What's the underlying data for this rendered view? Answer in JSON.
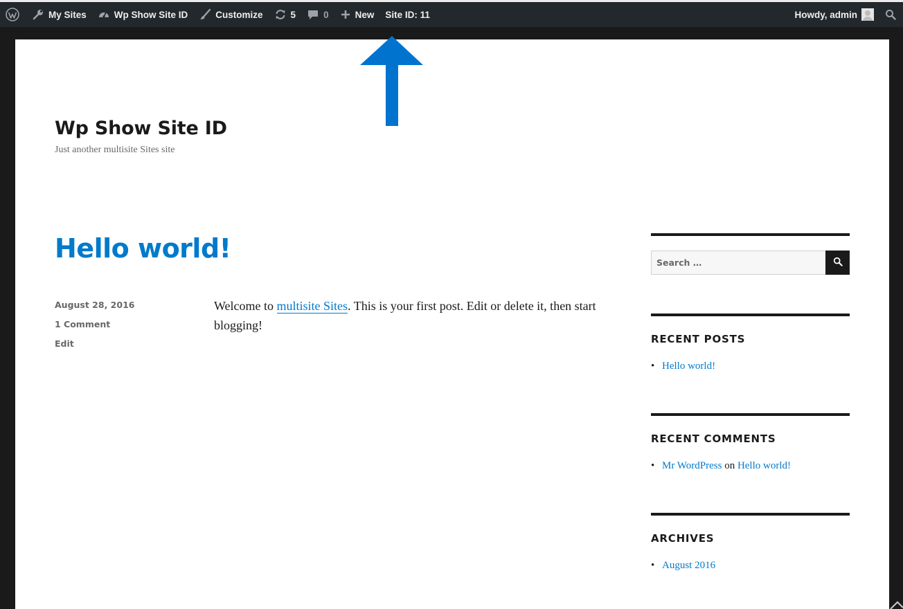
{
  "admin_bar": {
    "wp_logo_icon": "wordpress-logo-icon",
    "my_sites": "My Sites",
    "site_name": "Wp Show Site ID",
    "customize": "Customize",
    "updates_count": "5",
    "comments_count": "0",
    "new": "New",
    "site_id": "Site ID: 11",
    "howdy": "Howdy, admin",
    "colors": {
      "bg": "#23282d",
      "text": "#eeeeee",
      "muted": "#9ca2a7"
    }
  },
  "site": {
    "title": "Wp Show Site ID",
    "description": "Just another multisite Sites site"
  },
  "post": {
    "title": "Hello world!",
    "date": "August 28, 2016",
    "comments": "1 Comment",
    "edit": "Edit",
    "body_prefix": "Welcome to ",
    "body_link": "multisite Sites",
    "body_suffix": ". This is your first post. Edit or delete it, then start blogging!"
  },
  "sidebar": {
    "search": {
      "placeholder": "Search …"
    },
    "recent_posts": {
      "title": "RECENT POSTS",
      "items": [
        "Hello world!"
      ]
    },
    "recent_comments": {
      "title": "RECENT COMMENTS",
      "items": [
        {
          "author": "Mr WordPress",
          "on": "on",
          "post": "Hello world!"
        }
      ]
    },
    "archives": {
      "title": "ARCHIVES",
      "items": [
        "August 2016"
      ]
    }
  },
  "annotation": {
    "arrow_color": "#0073cf"
  },
  "colors": {
    "accent": "#007acc",
    "text": "#1a1a1a",
    "meta": "#686868",
    "frame": "#1a1a1a"
  }
}
